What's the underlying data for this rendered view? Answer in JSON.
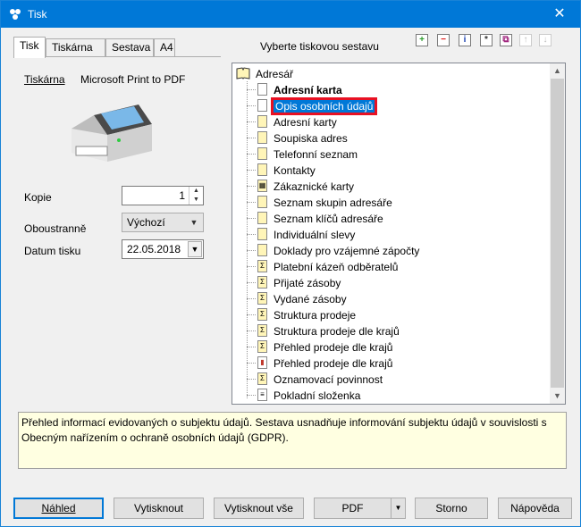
{
  "window": {
    "title": "Tisk",
    "close": "✕"
  },
  "tabs": [
    "Tisk",
    "Tiskárna",
    "Sestava",
    "A4"
  ],
  "printer": {
    "label": "Tiskárna",
    "value": "Microsoft Print to PDF"
  },
  "copies": {
    "label": "Kopie",
    "value": "1"
  },
  "duplex": {
    "label": "Oboustranně",
    "value": "Výchozí"
  },
  "print_date": {
    "label": "Datum tisku",
    "value": "22.05.2018"
  },
  "report_header": "Vyberte tiskovou sestavu",
  "toolbar_icons": [
    "add-icon",
    "remove-icon",
    "info-icon",
    "star-icon",
    "copy-icon",
    "move-up-icon",
    "move-down-icon"
  ],
  "tree": {
    "root": "Adresář",
    "items": [
      {
        "label": "Adresní karta",
        "icon": "page",
        "bold": true
      },
      {
        "label": "Opis osobních údajů",
        "icon": "page",
        "selected": true
      },
      {
        "label": "Adresní karty",
        "icon": "yellow"
      },
      {
        "label": "Soupiska adres",
        "icon": "yellow"
      },
      {
        "label": "Telefonní seznam",
        "icon": "yellow"
      },
      {
        "label": "Kontakty",
        "icon": "yellow"
      },
      {
        "label": "Zákaznické karty",
        "icon": "grid"
      },
      {
        "label": "Seznam skupin adresáře",
        "icon": "yellow"
      },
      {
        "label": "Seznam klíčů adresáře",
        "icon": "yellow"
      },
      {
        "label": "Individuální slevy",
        "icon": "yellow"
      },
      {
        "label": "Doklady pro vzájemné zápočty",
        "icon": "yellow"
      },
      {
        "label": "Platební kázeň odběratelů",
        "icon": "sigma"
      },
      {
        "label": "Přijaté zásoby",
        "icon": "sigma"
      },
      {
        "label": "Vydané zásoby",
        "icon": "sigma"
      },
      {
        "label": "Struktura prodeje",
        "icon": "sigma"
      },
      {
        "label": "Struktura prodeje dle krajů",
        "icon": "sigma"
      },
      {
        "label": "Přehled prodeje dle krajů",
        "icon": "sigma"
      },
      {
        "label": "Přehled prodeje dle krajů",
        "icon": "chart"
      },
      {
        "label": "Oznamovací povinnost",
        "icon": "sigma"
      },
      {
        "label": "Pokladní složenka",
        "icon": "doc"
      }
    ]
  },
  "description": "Přehled informací evidovaných o subjektu údajů. Sestava usnadňuje informování subjektu údajů v souvislosti s Obecným nařízením o ochraně osobních údajů (GDPR).",
  "buttons": {
    "preview": "Náhled",
    "print": "Vytisknout",
    "print_all": "Vytisknout vše",
    "pdf": "PDF",
    "cancel": "Storno",
    "help": "Nápověda"
  }
}
